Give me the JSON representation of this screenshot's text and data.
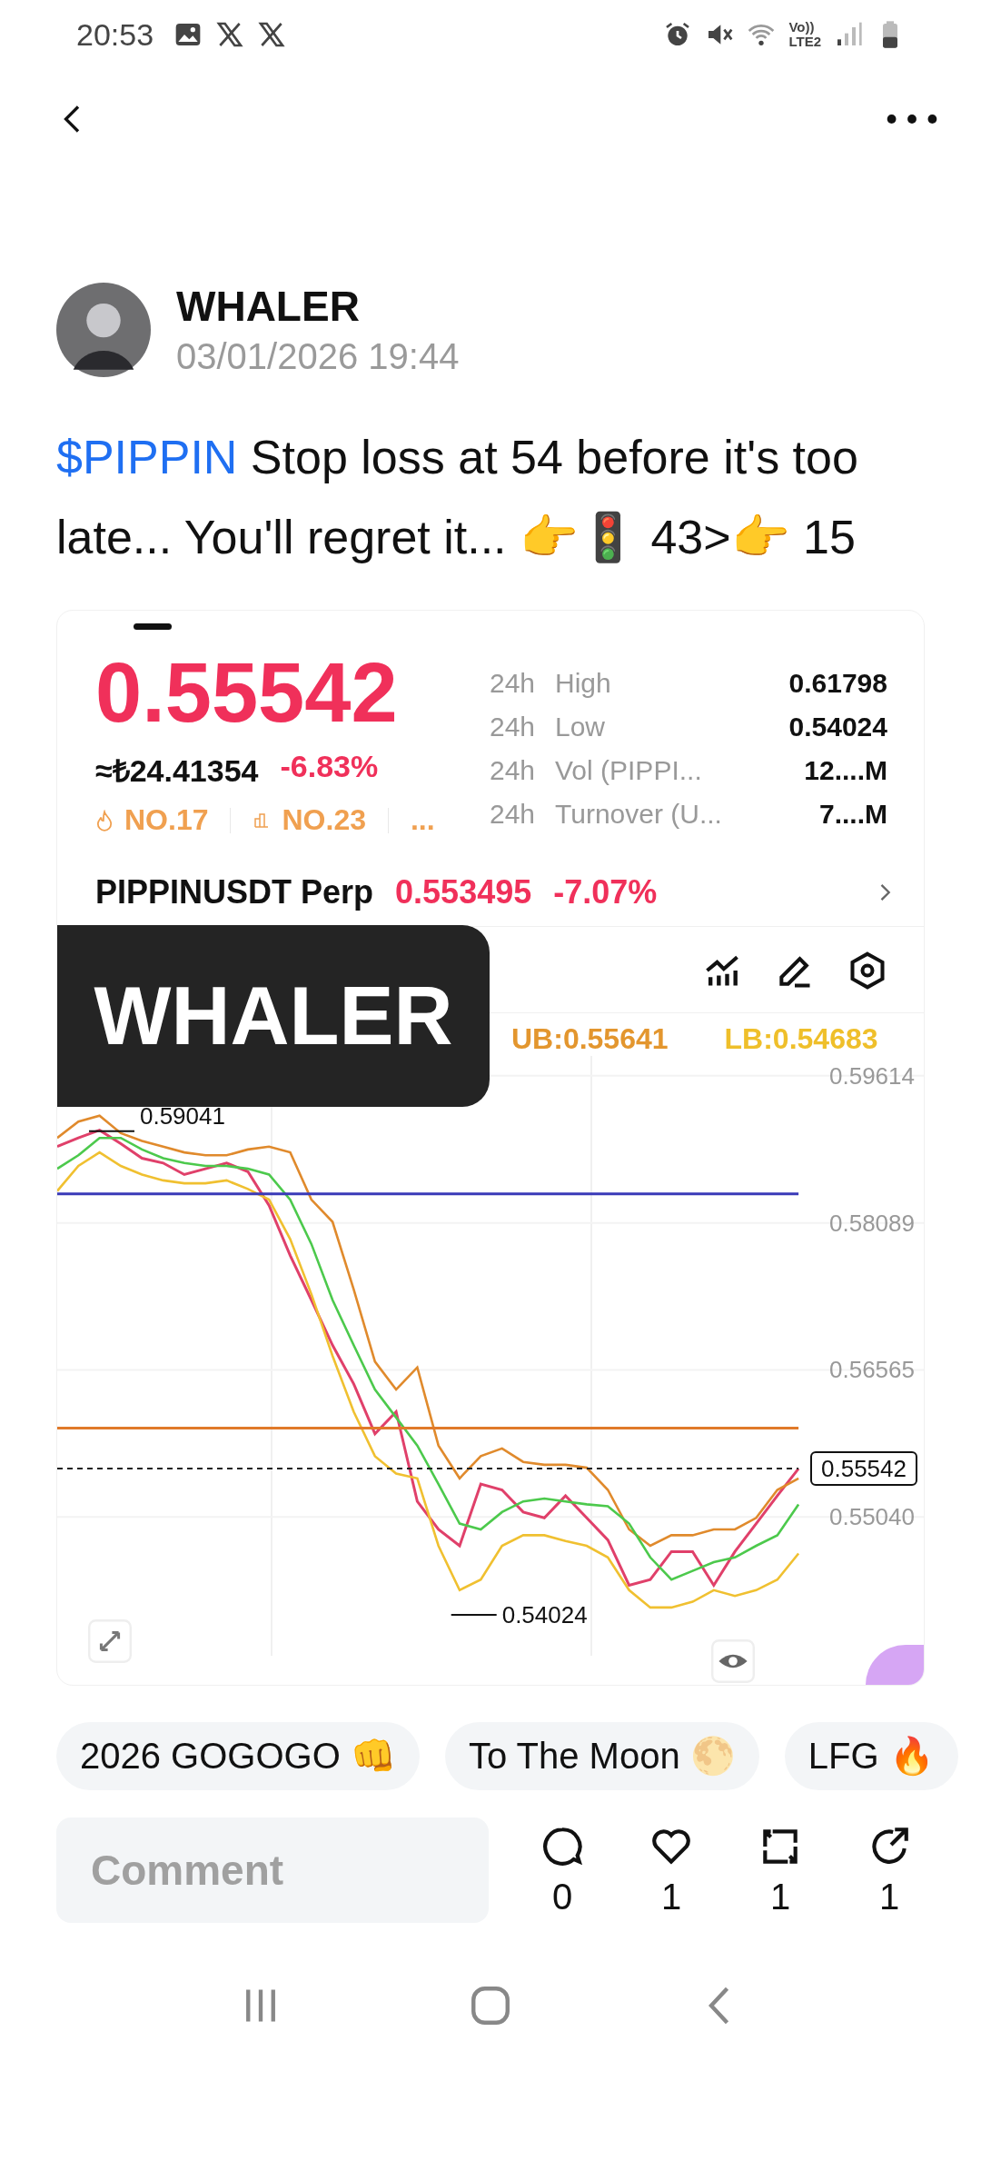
{
  "status_bar": {
    "time": "20:53",
    "network_top": "Vo))",
    "network_bottom": "LTE2"
  },
  "post": {
    "author": "WHALER",
    "date": "03/01/2026 19:44",
    "ticker": "$PIPPIN",
    "text": " Stop loss at 54 before it's too late... You'll regret it... 👉🚦 43>👉 15"
  },
  "embed": {
    "price": "0.55542",
    "fiat": "≈₺24.41354",
    "change": "-6.83%",
    "ranks": [
      "NO.17",
      "NO.23",
      "..."
    ],
    "stats": [
      {
        "period": "24h",
        "label": "High",
        "value": "0.61798"
      },
      {
        "period": "24h",
        "label": "Low",
        "value": "0.54024"
      },
      {
        "period": "24h",
        "label": "Vol (PIPPI...",
        "value": "12....M"
      },
      {
        "period": "24h",
        "label": "Turnover (U...",
        "value": "7....M"
      }
    ],
    "perp": {
      "name": "PIPPINUSDT Perp",
      "price": "0.553495",
      "change": "-7.07%"
    },
    "indicators": [
      {
        "text": "UB:0.55641",
        "color": "#e3962e"
      },
      {
        "text": "LB:0.54683",
        "color": "#efbf2a"
      }
    ],
    "overlay": "WHALER",
    "chart_data": {
      "type": "line",
      "categories": [
        null,
        null,
        null,
        null,
        null,
        null,
        null,
        null,
        null,
        null,
        null,
        null,
        null,
        null,
        null,
        null,
        null,
        null,
        null,
        null,
        null,
        null,
        null,
        null,
        null,
        null,
        null,
        null,
        null,
        null,
        null,
        null,
        null,
        null,
        null,
        null
      ],
      "ylim": [
        0.536,
        0.5982
      ],
      "grid": true,
      "yticks": [
        {
          "value": 0.5504,
          "label": "0.55040"
        },
        {
          "value": 0.56565,
          "label": "0.56565"
        },
        {
          "value": 0.58089,
          "label": "0.58089"
        },
        {
          "value": 0.59614,
          "label": "0.59614"
        }
      ],
      "series": [
        {
          "color": "#e0406a",
          "values": [
            0.5888,
            0.5897,
            0.5905,
            0.5891,
            0.5876,
            0.5871,
            0.5859,
            0.5865,
            0.5871,
            0.5862,
            0.5827,
            0.5775,
            0.5729,
            0.5682,
            0.5642,
            0.559,
            0.5613,
            0.552,
            0.5491,
            0.5474,
            0.5538,
            0.5532,
            0.5509,
            0.5503,
            0.5526,
            0.5503,
            0.548,
            0.5433,
            0.5439,
            0.5468,
            0.5468,
            0.5433,
            0.5468,
            0.5497,
            0.5526,
            0.5554
          ]
        },
        {
          "color": "#e08a2c",
          "values": [
            0.5897,
            0.5914,
            0.592,
            0.5902,
            0.5894,
            0.5888,
            0.5882,
            0.5879,
            0.5879,
            0.5885,
            0.5888,
            0.5882,
            0.5833,
            0.581,
            0.574,
            0.5665,
            0.5636,
            0.5659,
            0.5578,
            0.5544,
            0.5567,
            0.5575,
            0.5561,
            0.5558,
            0.5558,
            0.5555,
            0.5532,
            0.5491,
            0.5474,
            0.5485,
            0.5485,
            0.5491,
            0.5491,
            0.5503,
            0.5532,
            0.5544
          ]
        },
        {
          "color": "#4cc94c",
          "values": [
            0.5865,
            0.5879,
            0.5897,
            0.5897,
            0.5885,
            0.5876,
            0.5871,
            0.5868,
            0.5868,
            0.5865,
            0.5859,
            0.5833,
            0.5787,
            0.5729,
            0.5682,
            0.5636,
            0.5607,
            0.5578,
            0.5538,
            0.5497,
            0.5491,
            0.5509,
            0.552,
            0.5523,
            0.552,
            0.5517,
            0.5515,
            0.5497,
            0.5462,
            0.5439,
            0.5448,
            0.5457,
            0.5462,
            0.5474,
            0.5485,
            0.5517
          ]
        },
        {
          "color": "#f0c030",
          "values": [
            0.5842,
            0.5868,
            0.5882,
            0.5868,
            0.5859,
            0.5853,
            0.585,
            0.585,
            0.5853,
            0.5844,
            0.5833,
            0.5792,
            0.5735,
            0.5671,
            0.5613,
            0.5567,
            0.5549,
            0.5544,
            0.5474,
            0.5428,
            0.5439,
            0.5474,
            0.5485,
            0.5485,
            0.5479,
            0.5474,
            0.5462,
            0.5428,
            0.541,
            0.541,
            0.5416,
            0.5428,
            0.5422,
            0.5428,
            0.5439,
            0.5466
          ]
        },
        {
          "color": "#3a3ab8",
          "values": [
            0.5839,
            0.5839,
            0.5839,
            0.5839,
            0.5839,
            0.5839,
            0.5839,
            0.5839,
            0.5839,
            0.5839,
            0.5839,
            0.5839,
            0.5839,
            0.5839,
            0.5839,
            0.5839,
            0.5839,
            0.5839,
            0.5839,
            0.5839,
            0.5839,
            0.5839,
            0.5839,
            0.5839,
            0.5839,
            0.5839,
            0.5839,
            0.5839,
            0.5839,
            0.5839,
            0.5839,
            0.5839,
            0.5839,
            0.5839,
            0.5839,
            0.5839
          ]
        },
        {
          "color": "#e07a2a",
          "values": [
            0.5596,
            0.5596,
            0.5596,
            0.5596,
            0.5596,
            0.5596,
            0.5596,
            0.5596,
            0.5596,
            0.5596,
            0.5596,
            0.5596,
            0.5596,
            0.5596,
            0.5596,
            0.5596,
            0.5596,
            0.5596,
            0.5596,
            0.5596,
            0.5596,
            0.5596,
            0.5596,
            0.5596,
            0.5596,
            0.5596,
            0.5596,
            0.5596,
            0.5596,
            0.5596,
            0.5596,
            0.5596,
            0.5596,
            0.5596,
            0.5596,
            0.5596
          ]
        },
        {
          "color": "#222222",
          "line_style": "dashed",
          "values": [
            0.5554,
            0.5554,
            0.5554,
            0.5554,
            0.5554,
            0.5554,
            0.5554,
            0.5554,
            0.5554,
            0.5554,
            0.5554,
            0.5554,
            0.5554,
            0.5554,
            0.5554,
            0.5554,
            0.5554,
            0.5554,
            0.5554,
            0.5554,
            0.5554,
            0.5554,
            0.5554,
            0.5554,
            0.5554,
            0.5554,
            0.5554,
            0.5554,
            0.5554,
            0.5554,
            0.5554,
            0.5554,
            0.5554,
            0.5554,
            0.5554,
            0.5554
          ]
        }
      ],
      "annotations": [
        "0.59041",
        "0.54024",
        "0.55542"
      ]
    }
  },
  "tags": [
    "2026 GOGOGO 👊",
    "To The Moon 🌕",
    "LFG 🔥"
  ],
  "comment": {
    "placeholder": "Comment"
  },
  "actions": [
    {
      "kind": "comment",
      "count": "0"
    },
    {
      "kind": "like",
      "count": "1"
    },
    {
      "kind": "repost",
      "count": "1"
    },
    {
      "kind": "share",
      "count": "1"
    }
  ]
}
